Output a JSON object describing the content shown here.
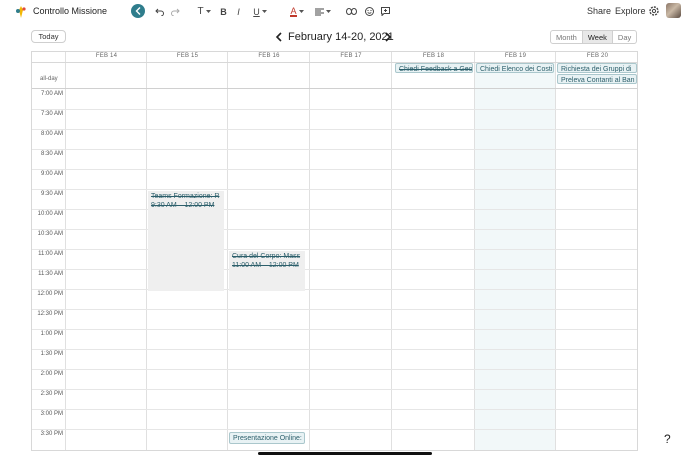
{
  "app": {
    "title": "Controllo Missione"
  },
  "toolbar": {
    "text_style": "T",
    "bold": "B",
    "italic": "I",
    "underline": "U",
    "text_color": "A",
    "share": "Share",
    "explore": "Explore"
  },
  "calendar": {
    "today_label": "Today",
    "range_title": "February 14-20, 2021",
    "views": [
      "Month",
      "Week",
      "Day"
    ],
    "active_view": "Week",
    "days": [
      "FEB 14",
      "FEB 15",
      "FEB 16",
      "FEB 17",
      "FEB 18",
      "FEB 19",
      "FEB 20"
    ],
    "allday_label": "all-day",
    "times": [
      "7:00 AM",
      "7:30 AM",
      "8:00 AM",
      "8:30 AM",
      "9:00 AM",
      "9:30 AM",
      "10:00 AM",
      "10:30 AM",
      "11:00 AM",
      "11:30 AM",
      "12:00 PM",
      "12:30 PM",
      "1:00 PM",
      "1:30 PM",
      "2:00 PM",
      "2:30 PM",
      "3:00 PM",
      "3:30 PM"
    ],
    "allday_events": [
      {
        "day": "FEB 18",
        "title": "Chiedi Feedback a Geo",
        "done": true
      },
      {
        "day": "FEB 19",
        "title": "Chiedi Elenco dei Costi",
        "done": false
      },
      {
        "day": "FEB 20",
        "title": "Richiesta dei Gruppi di",
        "done": false
      },
      {
        "day": "FEB 20",
        "title": "Preleva Contanti al Ban",
        "done": false
      }
    ],
    "timed_events": [
      {
        "day": "FEB 15",
        "title": "Teams Formazione: R",
        "time": "9:30 AM – 12:00 PM",
        "done": true
      },
      {
        "day": "FEB 16",
        "title": "Cura del Corpo: Mass",
        "time": "11:00 AM – 12:00 PM",
        "done": true
      },
      {
        "day": "FEB 16",
        "title": "Presentazione Online:",
        "time": "",
        "done": false
      }
    ]
  },
  "help": {
    "label": "?"
  },
  "colors": {
    "accent": "#2f7d8c",
    "today_column": "#f2f8f9",
    "event_text": "#2c5f6b"
  }
}
